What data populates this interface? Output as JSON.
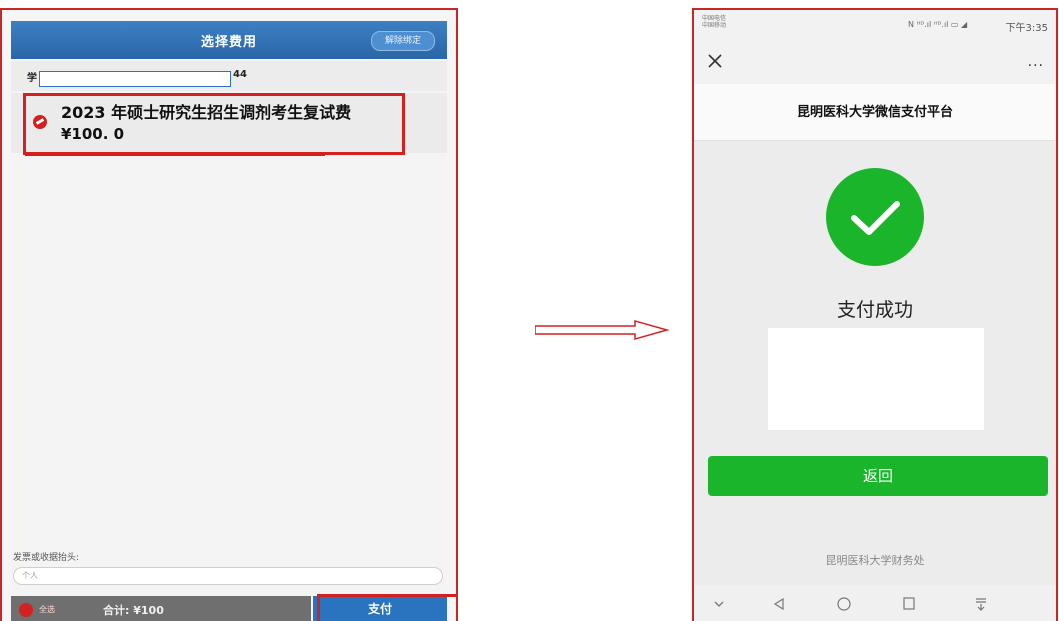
{
  "left": {
    "header_title": "选择费用",
    "unbind_label": "解除绑定",
    "student_prefix": "学",
    "student_value": "",
    "student_suffix": "44",
    "fee_name": "2023 年硕士研究生招生调剂考生复试费",
    "fee_amount": "¥100. 0",
    "invoice_label": "发票或收据抬头:",
    "invoice_placeholder": "个人",
    "select_all_label": "全选",
    "total_label": "合计: ¥100",
    "pay_label": "支付",
    "accent_color": "#2a73bf",
    "highlight_color": "#d32020"
  },
  "right": {
    "carrier_1": "中国电信",
    "carrier_2": "中国移动",
    "status_icons": "N ᴴᴰ.ıl ᴴᴰ.ıl ▭ ◢",
    "time": "下午3:35",
    "more_label": "···",
    "platform_title": "昆明医科大学微信支付平台",
    "success_text": "支付成功",
    "back_label": "返回",
    "footer_text": "昆明医科大学财务处",
    "accent_color": "#1bb52c"
  }
}
